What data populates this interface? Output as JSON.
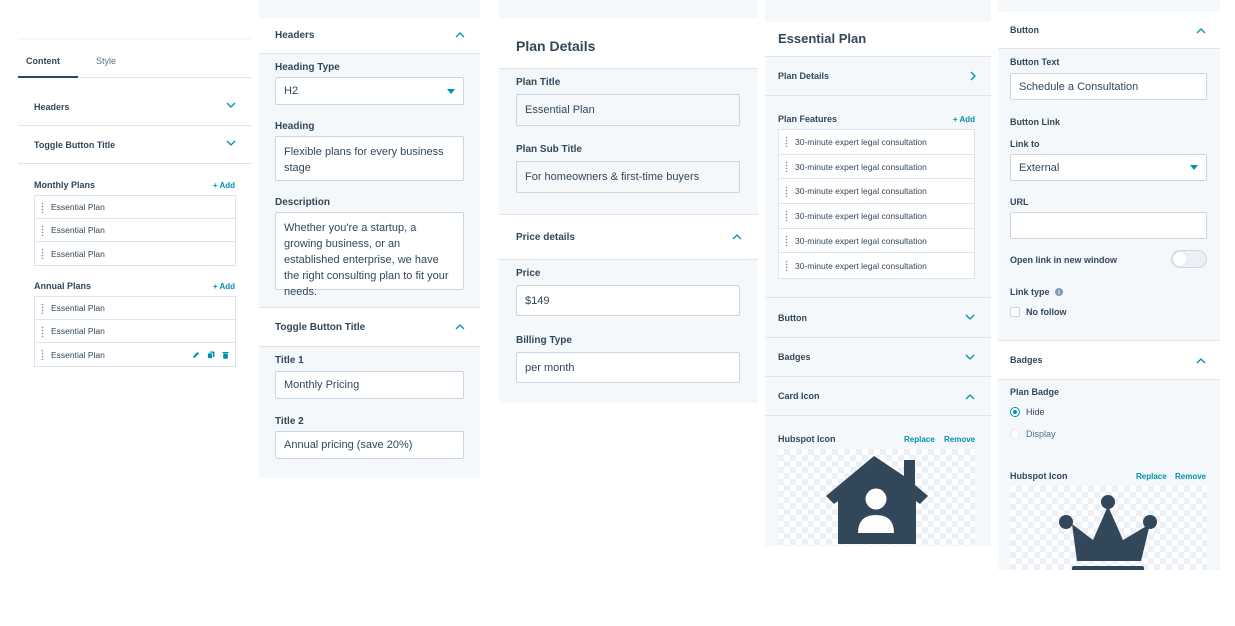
{
  "panel1": {
    "tabs": [
      "Content",
      "Style"
    ],
    "headers_label": "Headers",
    "toggle_label": "Toggle Button Title",
    "monthly_title": "Monthly Plans",
    "annual_title": "Annual Plans",
    "add_label": "+ Add",
    "monthly_items": [
      "Essential Plan",
      "Essential Plan",
      "Essential Plan"
    ],
    "annual_items": [
      "Essential Plan",
      "Essential Plan",
      "Essential Plan"
    ]
  },
  "panel2": {
    "headers_label": "Headers",
    "heading_type_label": "Heading Type",
    "heading_type_value": "H2",
    "heading_label": "Heading",
    "heading_value": "Flexible plans for every business stage",
    "description_label": "Description",
    "description_value": "Whether you're a startup, a growing business, or an established enterprise, we have the right consulting plan to fit your needs.",
    "toggle_label": "Toggle Button Title",
    "title1_label": "Title 1",
    "title1_value": "Monthly Pricing",
    "title2_label": "Title 2",
    "title2_value": "Annual pricing (save 20%)"
  },
  "panel3": {
    "title": "Plan Details",
    "plan_title_label": "Plan Title",
    "plan_title_value": "Essential Plan",
    "plan_sub_label": "Plan Sub Title",
    "plan_sub_value": "For homeowners & first-time buyers",
    "price_details_label": "Price details",
    "price_label": "Price",
    "price_value": "$149",
    "billing_label": "Billing Type",
    "billing_value": "per month"
  },
  "panel4": {
    "title": "Essential Plan",
    "plan_details_label": "Plan Details",
    "features_label": "Plan Features",
    "add_label": "+ Add",
    "features": [
      "30-minute expert legal consultation",
      "30-minute expert legal consultation",
      "30-minute expert legal consultation",
      "30-minute expert legal consultation",
      "30-minute expert legal consultation",
      "30-minute expert legal consultation"
    ],
    "button_label": "Button",
    "badges_label": "Badges",
    "card_icon_label": "Card Icon",
    "hubspot_icon_label": "Hubspot Icon",
    "replace_label": "Replace",
    "remove_label": "Remove",
    "icon_name": "house-user-icon",
    "icon_color": "#33475b"
  },
  "panel5": {
    "button_label": "Button",
    "button_text_label": "Button Text",
    "button_text_value": "Schedule a Consultation",
    "button_link_label": "Button Link",
    "link_to_label": "Link to",
    "link_to_value": "External",
    "url_label": "URL",
    "url_value": "",
    "new_window_label": "Open link in new window",
    "link_type_label": "Link type",
    "no_follow_label": "No follow",
    "badges_label": "Badges",
    "plan_badge_label": "Plan Badge",
    "hide_label": "Hide",
    "display_label": "Display",
    "hubspot_icon_label": "Hubspot Icon",
    "replace_label": "Replace",
    "remove_label": "Remove",
    "icon_name": "crown-icon"
  },
  "colors": {
    "accent": "#0091ae",
    "text": "#33475b",
    "border": "#dfe3eb",
    "panel_bg": "#f5f8fa"
  }
}
